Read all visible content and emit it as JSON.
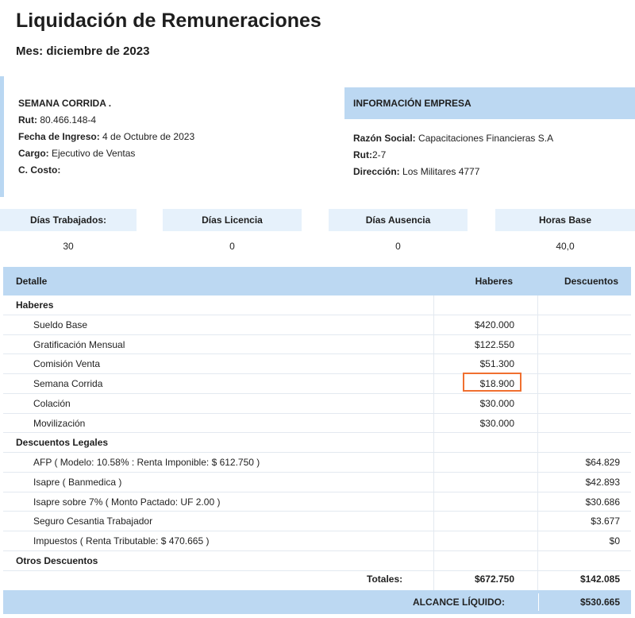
{
  "header": {
    "title": "Liquidación de Remuneraciones",
    "month": "Mes: diciembre de 2023"
  },
  "employee": {
    "name": "SEMANA CORRIDA .",
    "rut_label": "Rut:",
    "rut": " 80.466.148-4",
    "ingreso_label": "Fecha de Ingreso:",
    "ingreso": " 4 de Octubre de 2023",
    "cargo_label": "Cargo:",
    "cargo": " Ejecutivo de Ventas",
    "costo_label": "C. Costo:"
  },
  "company": {
    "header": "INFORMACIÓN EMPRESA",
    "razon_label": "Razón Social:",
    "razon": " Capacitaciones Financieras S.A",
    "rut_label": "Rut:",
    "rut": "2-7",
    "direccion_label": "Dirección:",
    "direccion": " Los Militares 4777"
  },
  "stats": [
    {
      "label": "Días Trabajados:",
      "value": "30"
    },
    {
      "label": "Días Licencia",
      "value": "0"
    },
    {
      "label": "Días Ausencia",
      "value": "0"
    },
    {
      "label": "Horas Base",
      "value": "40,0"
    }
  ],
  "table": {
    "headers": {
      "detalle": "Detalle",
      "haberes": "Haberes",
      "descuentos": "Descuentos"
    },
    "rows": [
      {
        "type": "section",
        "detalle": "Haberes",
        "haberes": "",
        "descuentos": ""
      },
      {
        "type": "item",
        "detalle": "Sueldo Base",
        "haberes": "$420.000",
        "descuentos": ""
      },
      {
        "type": "item",
        "detalle": "Gratificación Mensual",
        "haberes": "$122.550",
        "descuentos": ""
      },
      {
        "type": "item",
        "detalle": "Comisión Venta",
        "haberes": "$51.300",
        "descuentos": ""
      },
      {
        "type": "item",
        "detalle": "Semana Corrida",
        "haberes": "$18.900",
        "descuentos": ""
      },
      {
        "type": "item",
        "detalle": "Colación",
        "haberes": "$30.000",
        "descuentos": ""
      },
      {
        "type": "item",
        "detalle": "Movilización",
        "haberes": "$30.000",
        "descuentos": ""
      },
      {
        "type": "section",
        "detalle": "Descuentos Legales",
        "haberes": "",
        "descuentos": ""
      },
      {
        "type": "item",
        "detalle": "AFP ( Modelo: 10.58% : Renta Imponible: $ 612.750 )",
        "haberes": "",
        "descuentos": "$64.829"
      },
      {
        "type": "item",
        "detalle": "Isapre ( Banmedica )",
        "haberes": "",
        "descuentos": "$42.893"
      },
      {
        "type": "item",
        "detalle": "Isapre sobre 7% ( Monto Pactado: UF 2.00 )",
        "haberes": "",
        "descuentos": "$30.686"
      },
      {
        "type": "item",
        "detalle": "Seguro Cesantia Trabajador",
        "haberes": "",
        "descuentos": "$3.677"
      },
      {
        "type": "item",
        "detalle": "Impuestos ( Renta Tributable: $ 470.665 )",
        "haberes": "",
        "descuentos": "$0"
      },
      {
        "type": "section",
        "detalle": "Otros Descuentos",
        "haberes": "",
        "descuentos": ""
      }
    ]
  },
  "totals": {
    "label": "Totales:",
    "haberes": "$672.750",
    "descuentos": "$142.085"
  },
  "alcance": {
    "label": "ALCANCE LÍQUIDO:",
    "value": "$530.665"
  },
  "colors": {
    "accent": "#bcd8f2",
    "light": "#e6f1fb",
    "highlight": "#f07030"
  }
}
